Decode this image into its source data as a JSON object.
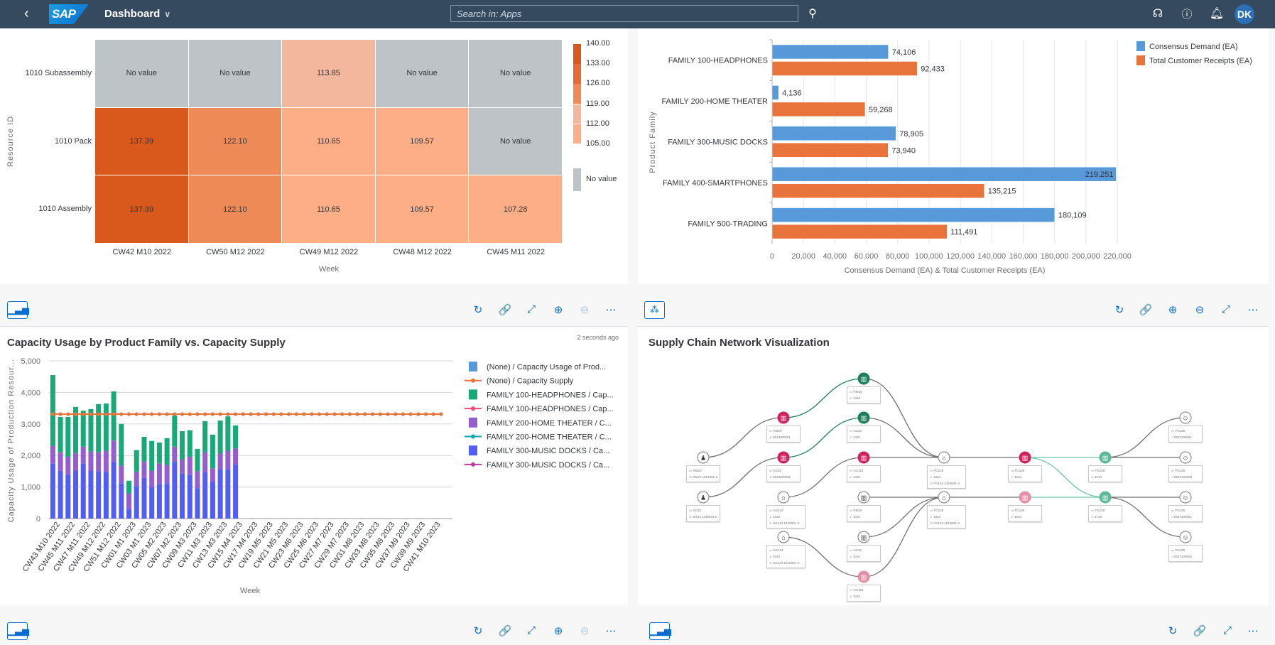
{
  "shell": {
    "back_icon": "chevron-left-icon",
    "logo": "SAP",
    "title": "Dashboard",
    "search_placeholder": "Search in: Apps",
    "icons": [
      "search-icon",
      "headset-icon",
      "help-icon",
      "bell-icon"
    ],
    "avatar_initials": "DK"
  },
  "toolbar": {
    "chart_icon": "bar-chart-icon",
    "network_icon": "network-icon",
    "refresh": "↻",
    "link": "🔗",
    "expand": "⤢",
    "zoom_in": "⊕",
    "zoom_out": "⊖",
    "more": "⋯"
  },
  "heatmap": {
    "chart_data": {
      "type": "heatmap",
      "xlabel": "Week",
      "ylabel": "Resource ID",
      "x_categories": [
        "CW42 M10 2022",
        "CW50 M12 2022",
        "CW49 M12 2022",
        "CW48 M12 2022",
        "CW45 M11 2022"
      ],
      "y_categories": [
        "1010 Subassembly",
        "1010 Pack",
        "1010 Assembly"
      ],
      "values": [
        [
          null,
          null,
          113.85,
          null,
          null
        ],
        [
          137.39,
          122.1,
          110.65,
          109.57,
          null
        ],
        [
          137.39,
          122.1,
          110.65,
          109.57,
          107.28
        ]
      ],
      "no_value_label": "No value",
      "legend_ticks": [
        "140.00",
        "133.00",
        "126.00",
        "119.00",
        "112.00",
        "105.00"
      ],
      "legend_colors": [
        "#d9581c",
        "#e46c34",
        "#ee8a57",
        "#f3b79d",
        "#fdae87"
      ],
      "no_value_color": "#bdc3c7"
    }
  },
  "barchart": {
    "chart_data": {
      "type": "bar",
      "orientation": "horizontal",
      "categories": [
        "FAMILY 100-HEADPHONES",
        "FAMILY 200-HOME THEATER",
        "FAMILY 300-MUSIC DOCKS",
        "FAMILY 400-SMARTPHONES",
        "FAMILY 500-TRADING"
      ],
      "series": [
        {
          "name": "Consensus Demand (EA)",
          "color": "#5899da",
          "values": [
            74106,
            4136,
            78905,
            219251,
            180109
          ],
          "labels": [
            "74,106",
            "4,136",
            "78,905",
            "219,251",
            "180,109"
          ]
        },
        {
          "name": "Total Customer Receipts (EA)",
          "color": "#e8743b",
          "values": [
            92433,
            59268,
            73940,
            135215,
            111491
          ],
          "labels": [
            "92,433",
            "59,268",
            "73,940",
            "135,215",
            "111,491"
          ]
        }
      ],
      "xlabel": "Consensus Demand (EA) & Total Customer Receipts (EA)",
      "ylabel": "Product Family",
      "xlim": [
        0,
        220000
      ],
      "x_ticks": [
        "0",
        "20,000",
        "40,000",
        "60,000",
        "80,000",
        "100,000",
        "120,000",
        "140,000",
        "160,000",
        "180,000",
        "200,000",
        "220,000"
      ],
      "grid": true,
      "legend": "top-right"
    }
  },
  "capacity": {
    "title": "Capacity Usage by Product Family vs. Capacity Supply",
    "updated": "2 seconds ago",
    "chart_data": {
      "type": "bar",
      "stacked": true,
      "xlabel": "Week",
      "ylabel": "Capacity Usage of Production Resour...",
      "ylim": [
        0,
        5000
      ],
      "y_ticks": [
        "0",
        "1,000",
        "2,000",
        "3,000",
        "4,000",
        "5,000"
      ],
      "x_tick_labels": [
        "CW43 M10 2022",
        "CW45 M11 2022",
        "CW47 M11 2022",
        "CW49 M12 2022",
        "CW51 M12 2022",
        "CW01 M1 2023",
        "CW03 M1 2023",
        "CW05 M2 2023",
        "CW07 M2 2023",
        "CW09 M3 2023",
        "CW11 M3 2023",
        "CW13 M3 2023",
        "CW15 M4 2023",
        "CW17 M4 2023",
        "CW19 M5 2023",
        "CW21 M5 2023",
        "CW23 M6 2023",
        "CW25 M6 2023",
        "CW27 M7 2023",
        "CW29 M7 2023",
        "CW31 M8 2023",
        "CW33 M8 2023",
        "CW35 M8 2023",
        "CW37 M9 2023",
        "CW39 M9 2023",
        "CW41 M10 2023"
      ],
      "series": [
        {
          "name": "FAMILY 300-MUSIC DOCKS / Ca...",
          "kind": "bar",
          "color": "#525df4",
          "values": [
            1750,
            1510,
            1400,
            1520,
            1750,
            1520,
            1500,
            1480,
            1800,
            1120,
            310,
            1030,
            1290,
            1000,
            1090,
            1120,
            1810,
            1420,
            1390,
            960,
            1480,
            1160,
            1570,
            1570,
            1720
          ]
        },
        {
          "name": "FAMILY 200-HOME THEATER / C...",
          "kind": "bar",
          "color": "#945ecf",
          "values": [
            550,
            590,
            560,
            560,
            530,
            610,
            600,
            670,
            670,
            560,
            490,
            460,
            520,
            520,
            660,
            580,
            470,
            450,
            570,
            540,
            620,
            430,
            490,
            580,
            500
          ]
        },
        {
          "name": "FAMILY 100-HEADPHONES / Cap...",
          "kind": "bar",
          "color": "#19a979",
          "values": [
            2250,
            1120,
            1260,
            1460,
            1140,
            1340,
            1530,
            1500,
            1560,
            1320,
            400,
            680,
            780,
            940,
            660,
            850,
            990,
            900,
            840,
            710,
            990,
            1070,
            1050,
            1090,
            730
          ]
        },
        {
          "name": "(None) / Capacity Supply",
          "kind": "line",
          "color": "#e8743b",
          "values": [
            3310,
            3310,
            3310,
            3310,
            3310,
            3310,
            3310,
            3310,
            3310,
            3310,
            3310,
            3310,
            3310,
            3310,
            3310,
            3310,
            3310,
            3310,
            3310,
            3310,
            3310,
            3310,
            3310,
            3310,
            3310,
            3310,
            3310,
            3310,
            3310,
            3310,
            3310,
            3310,
            3310,
            3310,
            3310,
            3310,
            3310,
            3310,
            3310,
            3310,
            3310,
            3310,
            3310,
            3310,
            3310,
            3310,
            3310,
            3310,
            3310,
            3310,
            3310,
            3310
          ]
        }
      ],
      "legend": [
        {
          "label": "(None) / Capacity Usage of Prod...",
          "kind": "bar",
          "color": "#5899da"
        },
        {
          "label": "(None) / Capacity Supply",
          "kind": "line",
          "color": "#e8743b"
        },
        {
          "label": "FAMILY 100-HEADPHONES / Cap...",
          "kind": "bar",
          "color": "#19a979"
        },
        {
          "label": "FAMILY 100-HEADPHONES / Cap...",
          "kind": "line",
          "color": "#ed4a7b"
        },
        {
          "label": "FAMILY 200-HOME THEATER / C...",
          "kind": "bar",
          "color": "#945ecf"
        },
        {
          "label": "FAMILY 200-HOME THEATER / C...",
          "kind": "line",
          "color": "#13a4b4"
        },
        {
          "label": "FAMILY 300-MUSIC DOCKS / Ca...",
          "kind": "bar",
          "color": "#525df4"
        },
        {
          "label": "FAMILY 300-MUSIC DOCKS / Ca...",
          "kind": "line",
          "color": "#bf399e"
        }
      ],
      "grid": true,
      "legend_position": "right"
    }
  },
  "network": {
    "title": "Supply Chain Network Visualization",
    "nodes": [
      {
        "id": "A1",
        "status": "neutral",
        "icon": "customer-icon",
        "lines": [
          "RM20",
          "RM20 1310001 S"
        ]
      },
      {
        "id": "A2",
        "status": "neutral",
        "icon": "customer-icon",
        "lines": [
          "SG25",
          "SG25 1310001 S"
        ]
      },
      {
        "id": "B1",
        "status": "critical",
        "icon": "warehouse-icon",
        "lines": [
          "RM20",
          "0013000001"
        ]
      },
      {
        "id": "B2",
        "status": "critical",
        "icon": "warehouse-icon",
        "lines": [
          "SG25",
          "0013000001"
        ]
      },
      {
        "id": "B3",
        "status": "neutral",
        "icon": "factory-icon",
        "lines": [
          "SG124",
          "1310",
          "SG124 1310001 S"
        ]
      },
      {
        "id": "B4",
        "status": "neutral",
        "icon": "factory-icon",
        "lines": [
          "SG124",
          "1010",
          "SG124 1010001 S"
        ]
      },
      {
        "id": "C0",
        "status": "good",
        "icon": "warehouse-icon",
        "lines": [
          "RM20",
          "1310"
        ]
      },
      {
        "id": "C1",
        "status": "good",
        "icon": "warehouse-icon",
        "lines": [
          "SG25",
          "1310"
        ]
      },
      {
        "id": "C2",
        "status": "critical",
        "icon": "warehouse-icon",
        "lines": [
          "SG124",
          "1310"
        ]
      },
      {
        "id": "C3",
        "status": "neutral",
        "icon": "warehouse-icon",
        "lines": [
          "RM20",
          "1010"
        ]
      },
      {
        "id": "C4",
        "status": "neutral",
        "icon": "warehouse-icon",
        "lines": [
          "SG25",
          "1010"
        ]
      },
      {
        "id": "C5",
        "status": "warning",
        "icon": "warehouse-icon",
        "lines": [
          "SG124",
          "1010"
        ]
      },
      {
        "id": "D1",
        "status": "neutral",
        "icon": "factory-icon",
        "lines": [
          "FG126",
          "1310",
          "FG126 1310001 S"
        ]
      },
      {
        "id": "D2",
        "status": "neutral",
        "icon": "factory-icon",
        "lines": [
          "FG126",
          "1010",
          "FG126 1010001 S"
        ]
      },
      {
        "id": "E1",
        "status": "critical",
        "icon": "warehouse-icon",
        "lines": [
          "FG126",
          "1310"
        ]
      },
      {
        "id": "E2",
        "status": "warning",
        "icon": "warehouse-icon",
        "lines": [
          "FG126",
          "1010"
        ]
      },
      {
        "id": "F1",
        "status": "ok",
        "icon": "warehouse-icon",
        "lines": [
          "FG126",
          "6210"
        ]
      },
      {
        "id": "F2",
        "status": "ok",
        "icon": "warehouse-icon",
        "lines": [
          "FG126",
          "2710"
        ]
      },
      {
        "id": "G1",
        "status": "neutral",
        "icon": "customer-ship-icon",
        "lines": [
          "FG126",
          "0062100001"
        ]
      },
      {
        "id": "G2",
        "status": "neutral",
        "icon": "customer-ship-icon",
        "lines": [
          "FG126",
          "0062100003"
        ]
      },
      {
        "id": "G3",
        "status": "neutral",
        "icon": "customer-ship-icon",
        "lines": [
          "FG126",
          "0027100001"
        ]
      },
      {
        "id": "G4",
        "status": "neutral",
        "icon": "customer-ship-icon",
        "lines": [
          "FG126",
          "0027100002"
        ]
      }
    ],
    "edges": [
      {
        "from": "A1",
        "to": "B1",
        "color": "#707070"
      },
      {
        "from": "B1",
        "to": "C0",
        "color": "#1e7f5c"
      },
      {
        "from": "A2",
        "to": "B2",
        "color": "#707070"
      },
      {
        "from": "B2",
        "to": "C1",
        "color": "#1e7f5c"
      },
      {
        "from": "B3",
        "to": "C2",
        "color": "#707070"
      },
      {
        "from": "B4",
        "to": "C5",
        "color": "#707070"
      },
      {
        "from": "C0",
        "to": "D1",
        "color": "#707070"
      },
      {
        "from": "C1",
        "to": "D1",
        "color": "#707070"
      },
      {
        "from": "C2",
        "to": "D1",
        "color": "#707070"
      },
      {
        "from": "C3",
        "to": "D2",
        "color": "#707070"
      },
      {
        "from": "C4",
        "to": "D2",
        "color": "#707070"
      },
      {
        "from": "C5",
        "to": "D2",
        "color": "#707070"
      },
      {
        "from": "D1",
        "to": "E1",
        "color": "#707070"
      },
      {
        "from": "D2",
        "to": "E2",
        "color": "#707070"
      },
      {
        "from": "E1",
        "to": "F1",
        "color": "#6cc6a8"
      },
      {
        "from": "E1",
        "to": "F2",
        "color": "#6cc6a8"
      },
      {
        "from": "E2",
        "to": "F2",
        "color": "#6cc6a8"
      },
      {
        "from": "F1",
        "to": "G1",
        "color": "#707070"
      },
      {
        "from": "F1",
        "to": "G2",
        "color": "#707070"
      },
      {
        "from": "F2",
        "to": "G3",
        "color": "#707070"
      },
      {
        "from": "F2",
        "to": "G4",
        "color": "#707070"
      }
    ],
    "status_colors": {
      "neutral": "#ffffff",
      "critical": "#d0225f",
      "good": "#1e7f5c",
      "warning": "#e58fa6",
      "ok": "#5dba97"
    }
  }
}
